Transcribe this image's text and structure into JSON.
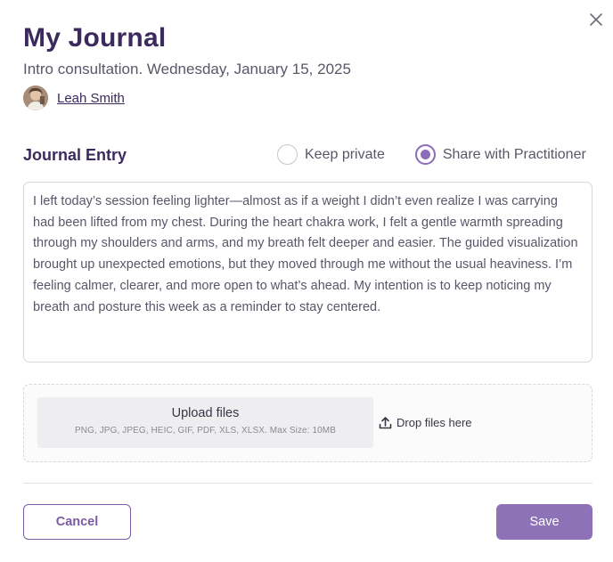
{
  "modal": {
    "title": "My Journal",
    "subtitle": "Intro consultation. Wednesday, January 15, 2025",
    "close_icon": "close-icon"
  },
  "practitioner": {
    "name": "Leah Smith",
    "avatar": "avatar-photo"
  },
  "entry": {
    "label": "Journal Entry",
    "text": "I left today’s session feeling lighter—almost as if a weight I didn’t even realize I was carrying had been lifted from my chest. During the heart chakra work, I felt a gentle warmth spreading through my shoulders and arms, and my breath felt deeper and easier. The guided visualization brought up unexpected emotions, but they moved through me without the usual heaviness. I’m feeling calmer, clearer, and more open to what’s ahead. My intention is to keep noticing my breath and posture this week as a reminder to stay centered."
  },
  "visibility": {
    "options": [
      {
        "label": "Keep private",
        "selected": false
      },
      {
        "label": "Share with Practitioner",
        "selected": true
      }
    ],
    "accent_color": "#8c6cb8"
  },
  "upload": {
    "button_label": "Upload files",
    "hint": "PNG, JPG, JPEG, HEIC, GIF, PDF, XLS, XLSX. Max Size: 10MB",
    "drop_label": "Drop files here",
    "drop_icon": "upload-icon"
  },
  "actions": {
    "cancel_label": "Cancel",
    "save_label": "Save",
    "brand_color": "#8d72b8"
  }
}
